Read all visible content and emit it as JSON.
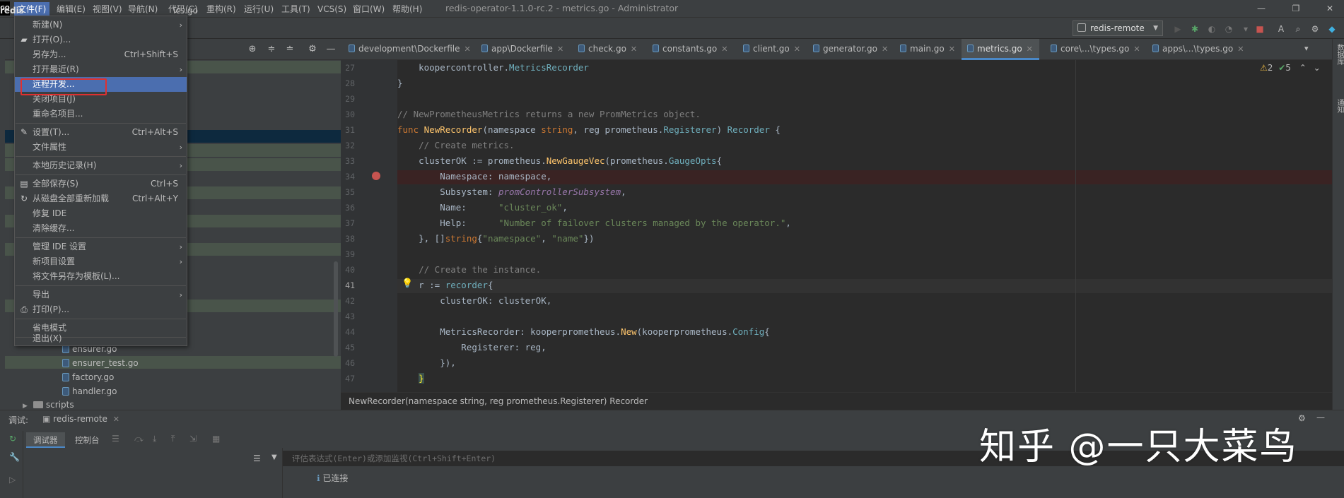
{
  "titlebar": {
    "logo": "GO",
    "window_title": "redis-operator-1.1.0-rc.2 - metrics.go - Administrator",
    "menus": [
      "文件(F)",
      "编辑(E)",
      "视图(V)",
      "导航(N)",
      "代码(C)",
      "重构(R)",
      "运行(U)",
      "工具(T)",
      "VCS(S)",
      "窗口(W)",
      "帮助(H)"
    ],
    "controls": {
      "minimize": "—",
      "restore": "❐",
      "close": "✕"
    }
  },
  "toolbar": {
    "project_crumb": "redis",
    "file_crumb": "ics.go",
    "run_config": "redis-remote"
  },
  "file_menu": {
    "items": [
      {
        "label": "新建(N)",
        "shortcut": "",
        "submenu": true,
        "icon": ""
      },
      {
        "label": "打开(O)...",
        "shortcut": "",
        "submenu": false,
        "icon": "folder-icon"
      },
      {
        "label": "另存为...",
        "shortcut": "Ctrl+Shift+S",
        "submenu": false,
        "icon": ""
      },
      {
        "label": "打开最近(R)",
        "shortcut": "",
        "submenu": true,
        "icon": ""
      },
      {
        "label": "远程开发...",
        "shortcut": "",
        "submenu": false,
        "icon": "",
        "selected": true
      },
      {
        "label": "关闭项目(J)",
        "shortcut": "",
        "submenu": false,
        "icon": ""
      },
      {
        "label": "重命名项目...",
        "shortcut": "",
        "submenu": false,
        "icon": ""
      },
      {
        "label": "设置(T)...",
        "shortcut": "Ctrl+Alt+S",
        "submenu": false,
        "icon": "wrench-icon"
      },
      {
        "label": "文件属性",
        "shortcut": "",
        "submenu": true,
        "icon": ""
      },
      {
        "label": "本地历史记录(H)",
        "shortcut": "",
        "submenu": true,
        "icon": ""
      },
      {
        "label": "全部保存(S)",
        "shortcut": "Ctrl+S",
        "submenu": false,
        "icon": "save-icon"
      },
      {
        "label": "从磁盘全部重新加载",
        "shortcut": "Ctrl+Alt+Y",
        "submenu": false,
        "icon": "reload-icon"
      },
      {
        "label": "修复 IDE",
        "shortcut": "",
        "submenu": false,
        "icon": ""
      },
      {
        "label": "清除缓存...",
        "shortcut": "",
        "submenu": false,
        "icon": ""
      },
      {
        "label": "管理 IDE 设置",
        "shortcut": "",
        "submenu": true,
        "icon": ""
      },
      {
        "label": "新项目设置",
        "shortcut": "",
        "submenu": true,
        "icon": ""
      },
      {
        "label": "将文件另存为模板(L)...",
        "shortcut": "",
        "submenu": false,
        "icon": ""
      },
      {
        "label": "导出",
        "shortcut": "",
        "submenu": true,
        "icon": ""
      },
      {
        "label": "打印(P)...",
        "shortcut": "",
        "submenu": false,
        "icon": "print-icon"
      },
      {
        "label": "省电模式",
        "shortcut": "",
        "submenu": false,
        "icon": ""
      },
      {
        "label": "退出(X)",
        "shortcut": "",
        "submenu": false,
        "icon": ""
      }
    ]
  },
  "project_tree": {
    "visible_items": [
      {
        "label": "ensurer.go",
        "type": "go-file"
      },
      {
        "label": "ensurer_test.go",
        "type": "go-file"
      },
      {
        "label": "factory.go",
        "type": "go-file"
      },
      {
        "label": "handler.go",
        "type": "go-file"
      },
      {
        "label": "scripts",
        "type": "folder"
      }
    ]
  },
  "editor_tabs": [
    {
      "label": "development\\Dockerfile",
      "active": false
    },
    {
      "label": "app\\Dockerfile",
      "active": false
    },
    {
      "label": "check.go",
      "active": false
    },
    {
      "label": "constants.go",
      "active": false
    },
    {
      "label": "client.go",
      "active": false
    },
    {
      "label": "generator.go",
      "active": false
    },
    {
      "label": "main.go",
      "active": false
    },
    {
      "label": "metrics.go",
      "active": true
    },
    {
      "label": "core\\...\\types.go",
      "active": false
    },
    {
      "label": "apps\\...\\types.go",
      "active": false
    }
  ],
  "editor": {
    "line_numbers": [
      "27",
      "28",
      "29",
      "30",
      "31",
      "32",
      "33",
      "34",
      "35",
      "36",
      "37",
      "38",
      "39",
      "40",
      "41",
      "42",
      "43",
      "44",
      "45",
      "46",
      "47"
    ],
    "current_line": "41",
    "inspections": {
      "warnings": "2",
      "ok": "5"
    },
    "breadcrumb": "NewRecorder(namespace string, reg prometheus.Registerer) Recorder"
  },
  "debug": {
    "label": "调试:",
    "session": "redis-remote",
    "tabs": [
      "调试器",
      "控制台"
    ],
    "eval_placeholder": "评估表达式(Enter)或添加监视(Ctrl+Shift+Enter)",
    "status": "已连接"
  },
  "watermark": "知乎 @一只大菜鸟",
  "right_stripe": {
    "labels": [
      "数据库",
      "通知"
    ]
  },
  "colors": {
    "menu_selected": "#4b6eaf",
    "highlight_box": "#e03030",
    "active_tab_underline": "#4a88c7"
  }
}
